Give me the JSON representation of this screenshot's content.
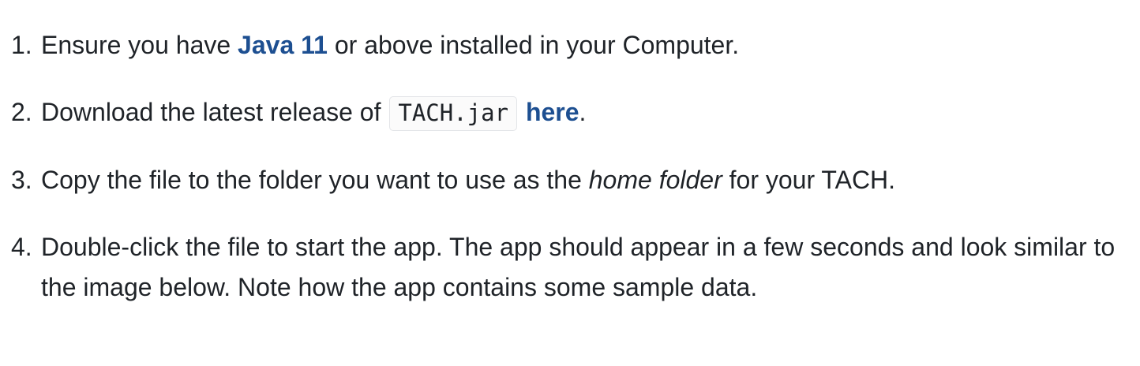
{
  "steps": [
    {
      "number": "1.",
      "before": "Ensure you have ",
      "link": "Java 11",
      "after": " or above installed in your Computer."
    },
    {
      "number": "2.",
      "before": "Download the latest release of ",
      "code": "TACH.jar",
      "link": "here",
      "after": "."
    },
    {
      "number": "3.",
      "before": "Copy the file to the folder you want to use as the ",
      "emphasis": "home folder",
      "after": " for your TACH."
    },
    {
      "number": "4.",
      "text": "Double-click the file to start the app. The app should appear in a few seconds and look similar to the image below. Note how the app contains some sample data."
    }
  ],
  "colors": {
    "link": "#1d4f91",
    "text": "#1f2328",
    "code_border": "#e3e5e8"
  }
}
